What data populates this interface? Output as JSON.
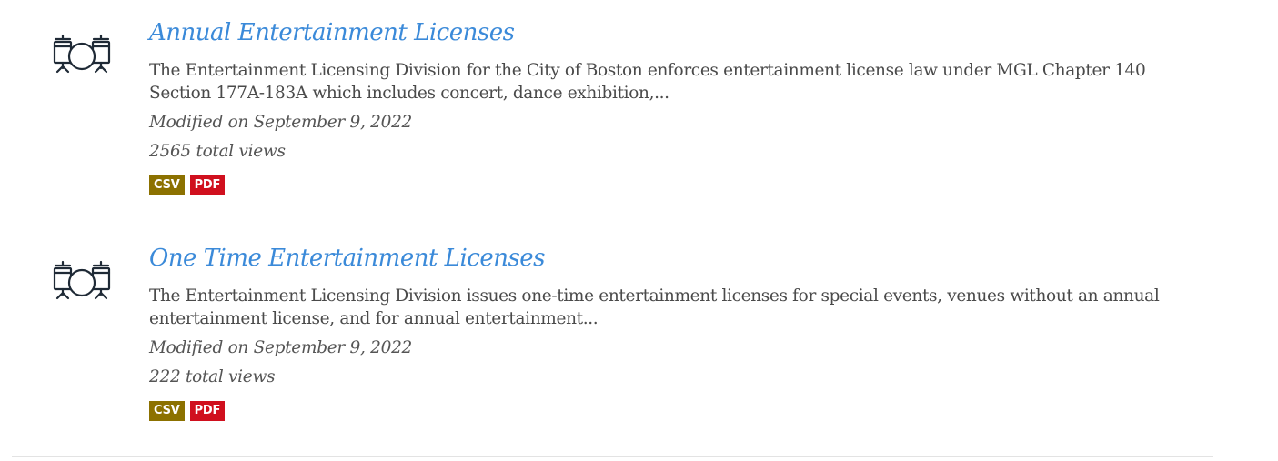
{
  "datasets": [
    {
      "icon": "drum-kit-icon",
      "title": "Annual Entertainment Licenses",
      "description": "The Entertainment Licensing Division for the City of Boston enforces entertainment license law under MGL Chapter 140 Section 177A-183A which includes concert, dance exhibition,...",
      "modified": "Modified on September 9, 2022",
      "views": "2565 total views",
      "formats": [
        "CSV",
        "PDF"
      ]
    },
    {
      "icon": "drum-kit-icon",
      "title": "One Time Entertainment Licenses",
      "description": "The Entertainment Licensing Division issues one-time entertainment licenses for special events, venues without an annual entertainment license, and for annual entertainment...",
      "modified": "Modified on September 9, 2022",
      "views": "222 total views",
      "formats": [
        "CSV",
        "PDF"
      ]
    }
  ],
  "colors": {
    "title": "#3b8ad9",
    "csv_badge": "#8c7100",
    "pdf_badge": "#d0101e",
    "icon": "#1f2a36"
  }
}
